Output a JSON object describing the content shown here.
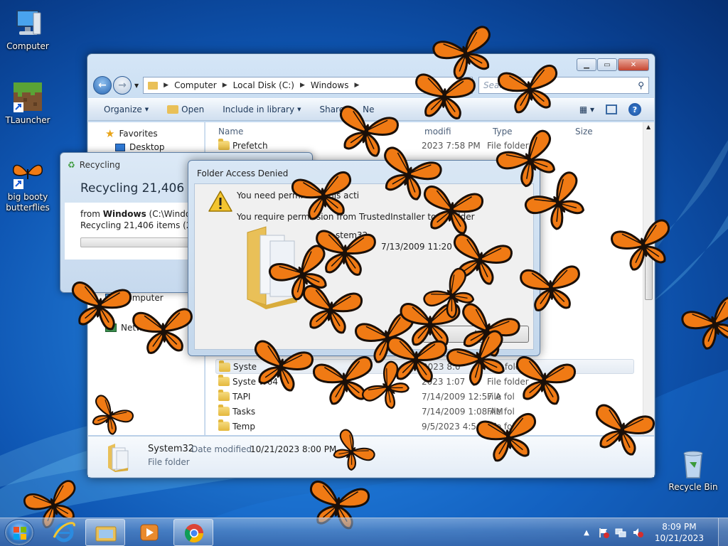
{
  "desktop": {
    "icons": [
      {
        "label": "Computer",
        "icon": "computer-icon"
      },
      {
        "label": "TLauncher",
        "icon": "minecraft-grass-block-icon"
      },
      {
        "label": "big booty butterflies",
        "icon": "butterfly-shortcut-icon"
      },
      {
        "label": "Recycle Bin",
        "icon": "recycle-bin-icon"
      }
    ]
  },
  "explorer": {
    "breadcrumb": [
      "Computer",
      "Local Disk (C:)",
      "Windows"
    ],
    "search_placeholder": "Search W    ws",
    "toolbar": {
      "organize": "Organize",
      "open": "Open",
      "include_in_library": "Include in library",
      "share_with": "Share",
      "new_folder": "Ne"
    },
    "nav": [
      {
        "label": "Favorites",
        "icon": "star-icon"
      },
      {
        "label": "Desktop",
        "icon": "desktop-icon"
      },
      {
        "label": "Computer",
        "icon": "computer-icon"
      },
      {
        "label": "Netwo",
        "icon": "network-icon"
      }
    ],
    "columns": {
      "name": "Name",
      "date": "modifi",
      "type": "Type",
      "size": "Size"
    },
    "files_top": [
      {
        "name": "Prefetch",
        "date": "2023 7:58 PM",
        "type": "File folder"
      }
    ],
    "files": [
      {
        "name": "Syste",
        "date": "2023 8:0",
        "type": "File folder",
        "selected": true
      },
      {
        "name": "Syste    W64",
        "date": "2023 1:07",
        "type": "File folder"
      },
      {
        "name": "TAPI",
        "date": "7/14/2009 12:57 A",
        "type": "File fol"
      },
      {
        "name": "Tasks",
        "date": "7/14/2009 1:08 AM",
        "type": "File fol"
      },
      {
        "name": "Temp",
        "date": "9/5/2023 4:54 PM",
        "type": "File fold"
      }
    ],
    "details": {
      "name": "System32",
      "date_label": "Date modified:",
      "date_value": "10/21/2023 8:00 PM",
      "type": "File folder"
    }
  },
  "recycling_dialog": {
    "title": "Recycling",
    "heading": "Recycling 21,406 item",
    "from_prefix": "from ",
    "from_bold": "Windows",
    "from_path": " (C:\\Window",
    "status": "Recycling 21,406 items (2.70"
  },
  "denied_dialog": {
    "title": "Folder Access Denied",
    "line1": "You need permi                   orm this acti",
    "line2": "You require permission from TrustedInstaller to m                   folder",
    "item_name": "stem32",
    "item_date": "7/13/2009 11:20",
    "button": "l"
  },
  "taskbar": {
    "time": "8:09 PM",
    "date": "10/21/2023",
    "apps": [
      "start-orb-icon",
      "internet-explorer-icon",
      "windows-explorer-icon",
      "media-player-icon",
      "chrome-icon"
    ]
  },
  "colors": {
    "butterfly_orange": "#f07a14",
    "butterfly_black": "#1a0f08",
    "desktop_blue": "#1e74cf"
  }
}
